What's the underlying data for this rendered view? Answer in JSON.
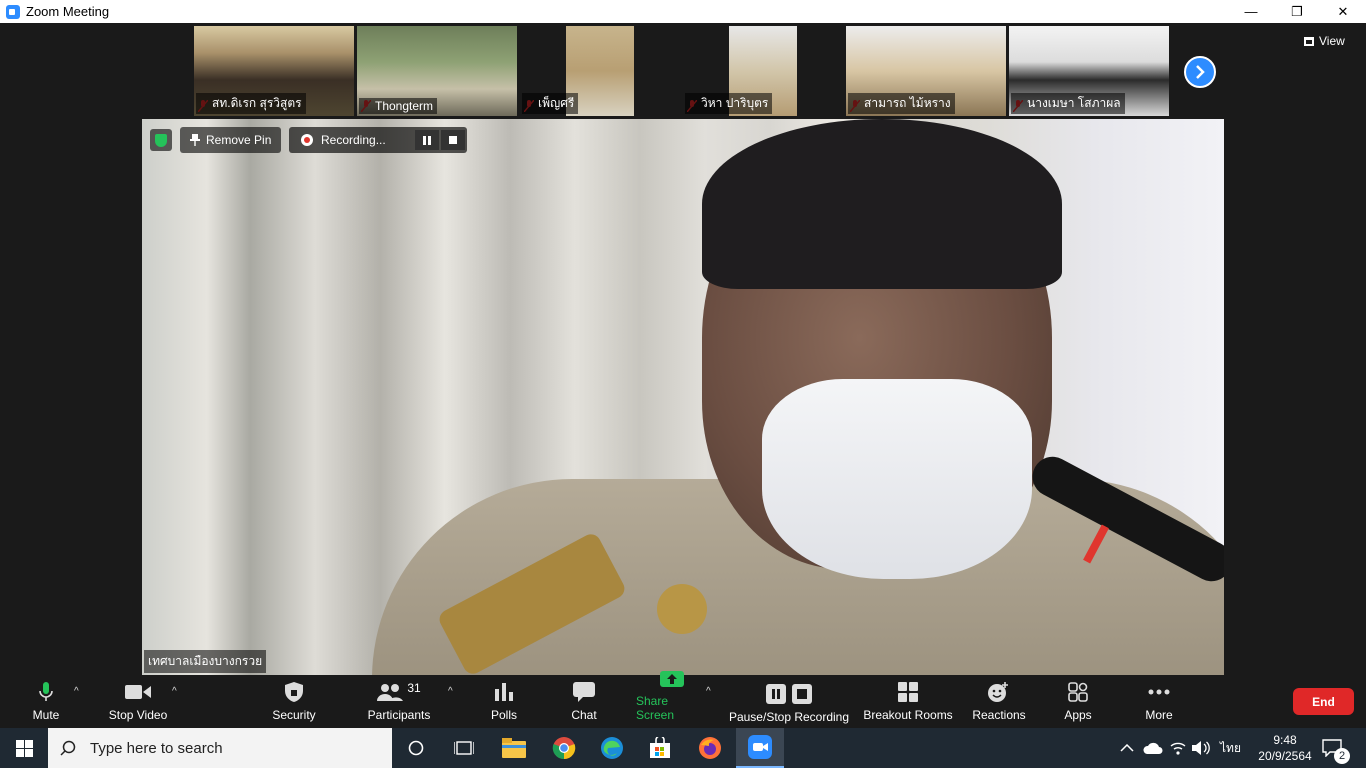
{
  "window": {
    "title": "Zoom Meeting",
    "controls": [
      "—",
      "❐",
      "✕"
    ]
  },
  "thumbnails": [
    {
      "name": "สท.ดิเรก สุรวิสูตร"
    },
    {
      "name": "Thongterm"
    },
    {
      "name": "เพ็ญศรี"
    },
    {
      "name": "วิหา ปาริบุตร"
    },
    {
      "name": "สามารถ ไม้หราง"
    },
    {
      "name": "นางเมษา โสภาผล"
    }
  ],
  "view_label": "View",
  "main_video": {
    "remove_pin_label": "Remove Pin",
    "recording_label": "Recording...",
    "speaker_name": "เทศบาลเมืองบางกรวย"
  },
  "toolbar": {
    "mute": "Mute",
    "stop_video": "Stop Video",
    "security": "Security",
    "participants": "Participants",
    "participants_count": "31",
    "polls": "Polls",
    "chat": "Chat",
    "share_screen": "Share Screen",
    "pause_stop_recording": "Pause/Stop Recording",
    "breakout_rooms": "Breakout Rooms",
    "reactions": "Reactions",
    "apps": "Apps",
    "more": "More",
    "end": "End"
  },
  "taskbar": {
    "search_placeholder": "Type here to search",
    "language": "ไทย",
    "time": "9:48",
    "date": "20/9/2564",
    "notification_count": "2"
  },
  "colors": {
    "accent": "#2d8cff",
    "end": "#e02828",
    "share": "#25c35a"
  }
}
